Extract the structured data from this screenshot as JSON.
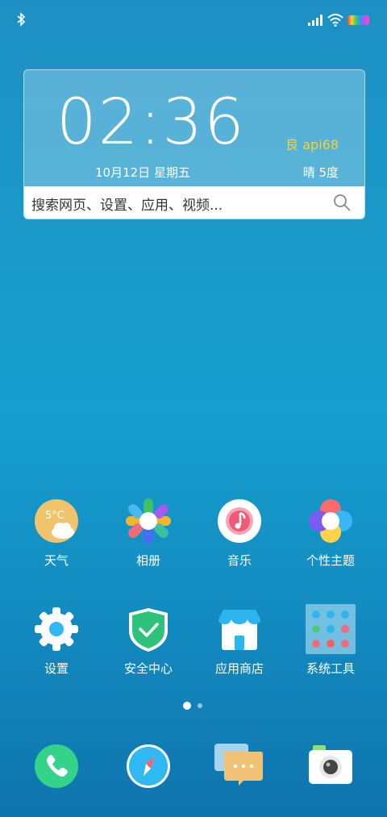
{
  "widget": {
    "time": "02:36",
    "aqi": "良 api68",
    "date": "10月12日 星期五",
    "weather": "晴 5度",
    "search_placeholder": "搜索网页、设置、应用、视频..."
  },
  "weather_icon_temp": "5°C",
  "apps_row1": [
    {
      "label": "天气",
      "icon": "weather-icon"
    },
    {
      "label": "相册",
      "icon": "gallery-icon"
    },
    {
      "label": "音乐",
      "icon": "music-icon"
    },
    {
      "label": "个性主题",
      "icon": "theme-icon"
    }
  ],
  "apps_row2": [
    {
      "label": "设置",
      "icon": "settings-icon"
    },
    {
      "label": "安全中心",
      "icon": "security-icon"
    },
    {
      "label": "应用商店",
      "icon": "app-store-icon"
    },
    {
      "label": "系统工具",
      "icon": "system-tools-folder"
    }
  ],
  "dock": [
    {
      "icon": "phone-icon"
    },
    {
      "icon": "browser-icon"
    },
    {
      "icon": "messages-icon"
    },
    {
      "icon": "camera-icon"
    }
  ],
  "page_indicator": {
    "current": 1,
    "total": 2
  }
}
